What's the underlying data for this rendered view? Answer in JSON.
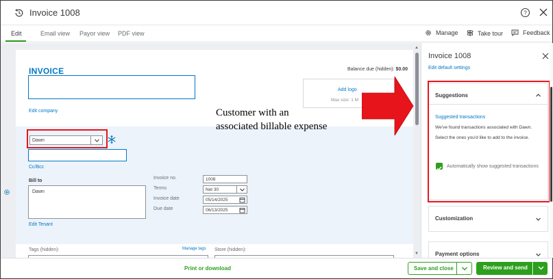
{
  "header": {
    "title": "Invoice 1008"
  },
  "tabs": [
    {
      "label": "Edit"
    },
    {
      "label": "Email view"
    },
    {
      "label": "Payor view"
    },
    {
      "label": "PDF view"
    }
  ],
  "tools": {
    "manage": "Manage",
    "take_tour": "Take tour",
    "feedback": "Feedback"
  },
  "invoice": {
    "heading": "INVOICE",
    "balance_label": "Balance due (hidden):",
    "balance_value": "$0.00",
    "edit_company": "Edit company",
    "add_logo": "Add logo",
    "max_size": "Max size: 1 M",
    "customer_value": "Dawn",
    "cc_bcc": "Cc/Bcc",
    "bill_to_label": "Bill to",
    "bill_to_value": "Dawn",
    "edit_tenant": "Edit Tenant",
    "fields": [
      {
        "label": "Invoice no.",
        "value": "1008"
      },
      {
        "label": "Terms",
        "value": "Net 30"
      },
      {
        "label": "Invoice date",
        "value": "05/14/2025"
      },
      {
        "label": "Due date",
        "value": "06/13/2025"
      }
    ],
    "tags_label": "Tags (hidden):",
    "manage_tags": "Manage tags",
    "store_label": "Store (hidden):"
  },
  "annotation": {
    "line1": "Customer with an",
    "line2": "associated billable expense",
    "arrow_color": "#e8141b"
  },
  "panel": {
    "title": "Invoice 1008",
    "edit_defaults": "Edit default settings",
    "suggestions_title": "Suggestions",
    "suggested_transactions": "Suggested transactions",
    "suggestions_body": "We've found transactions associated with Dawn. Select the ones you'd like to add to the invoice.",
    "auto_show_label": "Automatically show suggested transactions",
    "customization_title": "Customization",
    "payment_options_title": "Payment options"
  },
  "footer": {
    "print_download": "Print or download",
    "save_close": "Save and close",
    "review_send": "Review and send"
  },
  "colors": {
    "accent_green": "#2ca01c",
    "link_blue": "#0077c5",
    "annotation_red": "#e8141b"
  }
}
